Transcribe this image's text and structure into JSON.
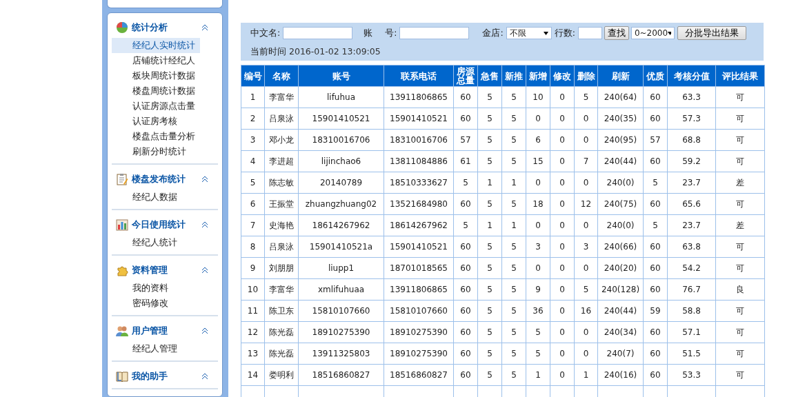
{
  "sidebar": {
    "sections": [
      {
        "title": "统计分析",
        "expanded": true,
        "items": [
          {
            "label": "经纪人实时统计",
            "selected": true
          },
          {
            "label": "店铺统计经纪人",
            "selected": false
          },
          {
            "label": "板块周统计数据",
            "selected": false
          },
          {
            "label": "楼盘周统计数据",
            "selected": false
          },
          {
            "label": "认证房源点击量",
            "selected": false
          },
          {
            "label": "认证房考核",
            "selected": false
          },
          {
            "label": "楼盘点击量分析",
            "selected": false
          },
          {
            "label": "刷新分时统计",
            "selected": false
          }
        ]
      },
      {
        "title": "楼盘发布统计",
        "expanded": true,
        "items": [
          {
            "label": "经纪人数据",
            "selected": false
          }
        ]
      },
      {
        "title": "今日使用统计",
        "expanded": true,
        "items": [
          {
            "label": "经纪人统计",
            "selected": false
          }
        ]
      },
      {
        "title": "资料管理",
        "expanded": true,
        "items": [
          {
            "label": "我的资料",
            "selected": false
          },
          {
            "label": "密码修改",
            "selected": false
          }
        ]
      },
      {
        "title": "用户管理",
        "expanded": true,
        "items": [
          {
            "label": "经纪人管理",
            "selected": false
          }
        ]
      },
      {
        "title": "我的助手",
        "expanded": true
      }
    ]
  },
  "filters": {
    "name_label": "中文名:",
    "account_label_1": "账",
    "account_label_2": "号:",
    "store_label": "金店:",
    "store_value": "不限",
    "rows_label": "行数:",
    "search_button": "查找",
    "range_value": "0~2000",
    "export_button": "分批导出结果",
    "time_label": "当前时间",
    "time_value": "2016-01-02 13:09:05"
  },
  "table": {
    "columns": [
      "编号",
      "名称",
      "账号",
      "联系电话",
      "房源总量",
      "急售",
      "新推",
      "新增",
      "修改",
      "删除",
      "刷新",
      "优质",
      "考核分值",
      "评比结果"
    ],
    "rows": [
      [
        "1",
        "李富华",
        "lifuhua",
        "13911806865",
        "60",
        "5",
        "5",
        "10",
        "0",
        "5",
        "240(64)",
        "60",
        "63.3",
        "可"
      ],
      [
        "2",
        "吕泉泳",
        "15901410521",
        "15901410521",
        "60",
        "5",
        "5",
        "0",
        "0",
        "0",
        "240(35)",
        "60",
        "57.3",
        "可"
      ],
      [
        "3",
        "邓小龙",
        "18310016706",
        "18310016706",
        "57",
        "5",
        "5",
        "6",
        "0",
        "0",
        "240(95)",
        "57",
        "68.8",
        "可"
      ],
      [
        "4",
        "李进超",
        "lijinchao6",
        "13811084886",
        "61",
        "5",
        "5",
        "15",
        "0",
        "7",
        "240(44)",
        "60",
        "59.2",
        "可"
      ],
      [
        "5",
        "陈志敏",
        "20140789",
        "18510333627",
        "5",
        "1",
        "1",
        "0",
        "0",
        "0",
        "240(0)",
        "5",
        "23.7",
        "差"
      ],
      [
        "6",
        "王振堂",
        "zhuangzhuang02",
        "13521684980",
        "60",
        "5",
        "5",
        "18",
        "0",
        "12",
        "240(75)",
        "60",
        "65.6",
        "可"
      ],
      [
        "7",
        "史海艳",
        "18614267962",
        "18614267962",
        "5",
        "1",
        "1",
        "0",
        "0",
        "0",
        "240(0)",
        "5",
        "23.7",
        "差"
      ],
      [
        "8",
        "吕泉泳",
        "15901410521a",
        "15901410521",
        "60",
        "5",
        "5",
        "3",
        "0",
        "3",
        "240(66)",
        "60",
        "63.8",
        "可"
      ],
      [
        "9",
        "刘朋朋",
        "liupp1",
        "18701018565",
        "60",
        "5",
        "5",
        "0",
        "0",
        "0",
        "240(20)",
        "60",
        "54.2",
        "可"
      ],
      [
        "10",
        "李富华",
        "xmlifuhuaa",
        "13911806865",
        "60",
        "5",
        "5",
        "9",
        "0",
        "5",
        "240(128)",
        "60",
        "76.7",
        "良"
      ],
      [
        "11",
        "陈卫东",
        "15810107660",
        "15810107660",
        "60",
        "5",
        "5",
        "36",
        "0",
        "16",
        "240(44)",
        "59",
        "58.8",
        "可"
      ],
      [
        "12",
        "陈光磊",
        "18910275390",
        "18910275390",
        "60",
        "5",
        "5",
        "5",
        "0",
        "0",
        "240(34)",
        "60",
        "57.1",
        "可"
      ],
      [
        "13",
        "陈光磊",
        "13911325803",
        "18910275390",
        "60",
        "5",
        "5",
        "5",
        "0",
        "0",
        "240(7)",
        "60",
        "51.5",
        "可"
      ],
      [
        "14",
        "娄明利",
        "18516860827",
        "18516860827",
        "60",
        "5",
        "5",
        "1",
        "0",
        "1",
        "240(16)",
        "60",
        "53.3",
        "可"
      ]
    ]
  }
}
